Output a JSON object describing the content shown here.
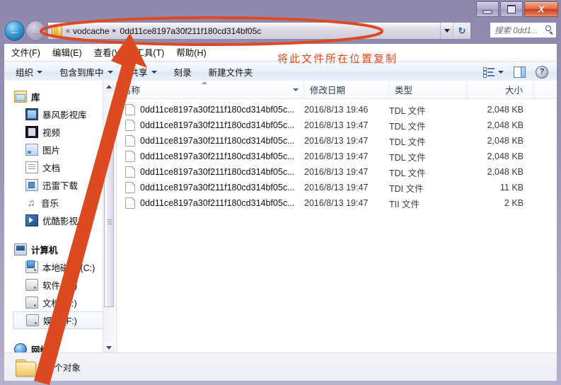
{
  "window": {
    "controls": {
      "minimize": "–",
      "maximize": "□",
      "close": "X"
    }
  },
  "nav": {
    "back_icon": "←",
    "forward_icon": "→",
    "address": {
      "folder_icon": "folder-icon",
      "overflow": "«",
      "crumb1": "vodcache",
      "separator": "▸",
      "crumb2": "0dd11ce8197a30f211f180cd314bf05c",
      "dropdown_icon": "chevron-down-icon",
      "refresh_icon": "↻"
    },
    "search": {
      "placeholder": "搜索 0dd1...",
      "icon": "search-icon"
    }
  },
  "menubar": {
    "items": [
      {
        "label": "文件(F)"
      },
      {
        "label": "编辑(E)"
      },
      {
        "label": "查看(V)"
      },
      {
        "label": "工具(T)"
      },
      {
        "label": "帮助(H)"
      }
    ]
  },
  "toolbar": {
    "items": [
      {
        "label": "组织",
        "caret": true
      },
      {
        "label": "包含到库中",
        "caret": true
      },
      {
        "label": "共享",
        "caret": true
      },
      {
        "label": "刻录",
        "caret": false
      },
      {
        "label": "新建文件夹",
        "caret": false
      }
    ],
    "view_icon": "view-list-icon",
    "view_caret": "chevron-down-icon",
    "preview_icon": "preview-pane-icon",
    "help_icon": "help-icon",
    "help_glyph": "?"
  },
  "sidebar": {
    "groups": [
      {
        "root": {
          "label": "库",
          "icon": "library-icon"
        },
        "children": [
          {
            "label": "暴风影视库",
            "icon": "video-library-icon"
          },
          {
            "label": "视频",
            "icon": "videos-icon"
          },
          {
            "label": "图片",
            "icon": "pictures-icon"
          },
          {
            "label": "文档",
            "icon": "documents-icon"
          },
          {
            "label": "迅雷下载",
            "icon": "thunder-download-icon"
          },
          {
            "label": "音乐",
            "icon": "music-icon"
          },
          {
            "label": "优酷影视库",
            "icon": "youku-library-icon"
          }
        ]
      },
      {
        "root": {
          "label": "计算机",
          "icon": "computer-icon"
        },
        "children": [
          {
            "label": "本地磁盘 (C:)",
            "icon": "system-drive-icon",
            "selected": false
          },
          {
            "label": "软件 (D:)",
            "icon": "drive-icon",
            "selected": false
          },
          {
            "label": "文档 (E:)",
            "icon": "drive-icon",
            "selected": false
          },
          {
            "label": "娱乐 (F:)",
            "icon": "drive-icon",
            "selected": true
          }
        ]
      },
      {
        "root": {
          "label": "网络",
          "icon": "network-icon"
        },
        "children": []
      }
    ],
    "scrollbar": {
      "up_icon": "scroll-up-icon",
      "down_icon": "scroll-down-icon"
    }
  },
  "filelist": {
    "columns": [
      {
        "key": "name",
        "label": "名称"
      },
      {
        "key": "date",
        "label": "修改日期"
      },
      {
        "key": "type",
        "label": "类型"
      },
      {
        "key": "size",
        "label": "大小"
      }
    ],
    "rows": [
      {
        "name": "0dd11ce8197a30f211f180cd314bf05c...",
        "date": "2016/8/13 19:46",
        "type": "TDL 文件",
        "size": "2,048 KB"
      },
      {
        "name": "0dd11ce8197a30f211f180cd314bf05c...",
        "date": "2016/8/13 19:47",
        "type": "TDL 文件",
        "size": "2,048 KB"
      },
      {
        "name": "0dd11ce8197a30f211f180cd314bf05c...",
        "date": "2016/8/13 19:47",
        "type": "TDL 文件",
        "size": "2,048 KB"
      },
      {
        "name": "0dd11ce8197a30f211f180cd314bf05c...",
        "date": "2016/8/13 19:47",
        "type": "TDL 文件",
        "size": "2,048 KB"
      },
      {
        "name": "0dd11ce8197a30f211f180cd314bf05c...",
        "date": "2016/8/13 19:47",
        "type": "TDL 文件",
        "size": "2,048 KB"
      },
      {
        "name": "0dd11ce8197a30f211f180cd314bf05c...",
        "date": "2016/8/13 19:47",
        "type": "TDI 文件",
        "size": "11 KB"
      },
      {
        "name": "0dd11ce8197a30f211f180cd314bf05c...",
        "date": "2016/8/13 19:47",
        "type": "TII 文件",
        "size": "2 KB"
      }
    ]
  },
  "statusbar": {
    "folder_icon": "folder-icon",
    "text": "7 个对象"
  },
  "annotation": {
    "text": "将此文件所在位置复制",
    "color": "#e0491f",
    "ellipse": "address-bar-highlight",
    "arrow": "pointer-arrow"
  }
}
